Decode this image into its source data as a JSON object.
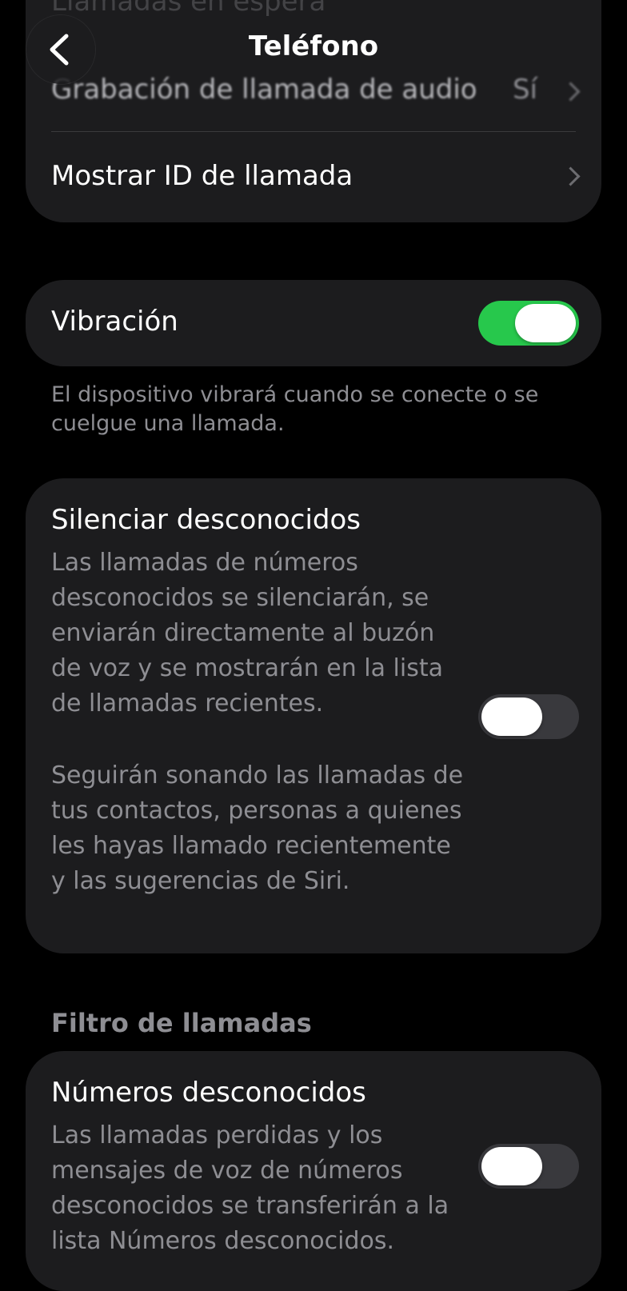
{
  "header": {
    "title": "Teléfono",
    "back_icon": "chevron-left-icon"
  },
  "top_group": {
    "ghost_label": "Llamadas en espera",
    "items": [
      {
        "label": "Grabación de llamada de audio",
        "value": "Sí"
      },
      {
        "label": "Mostrar ID de llamada",
        "value": ""
      }
    ]
  },
  "vibration": {
    "label": "Vibración",
    "enabled": true,
    "footnote": "El dispositivo vibrará cuando se conecte o se cuelgue una llamada."
  },
  "silence_unknown": {
    "title": "Silenciar desconocidos",
    "description_1": "Las llamadas de números desconocidos se silenciarán, se enviarán directamente al buzón de voz y se mostrarán en la lista de llamadas recientes.",
    "description_2": "Seguirán sonando las llamadas de tus contactos, personas a quienes les hayas llamado recientemente y las sugerencias de Siri.",
    "enabled": false
  },
  "call_filter": {
    "section_title": "Filtro de llamadas",
    "title": "Números desconocidos",
    "description": "Las llamadas perdidas y los mensajes de voz de números desconocidos se transferirán a la lista Números desconocidos.",
    "enabled": false
  },
  "colors": {
    "background": "#000000",
    "card": "#1c1c1e",
    "toggle_on": "#27c84c",
    "toggle_off": "#39393d",
    "secondary_text": "#8e8e93"
  }
}
